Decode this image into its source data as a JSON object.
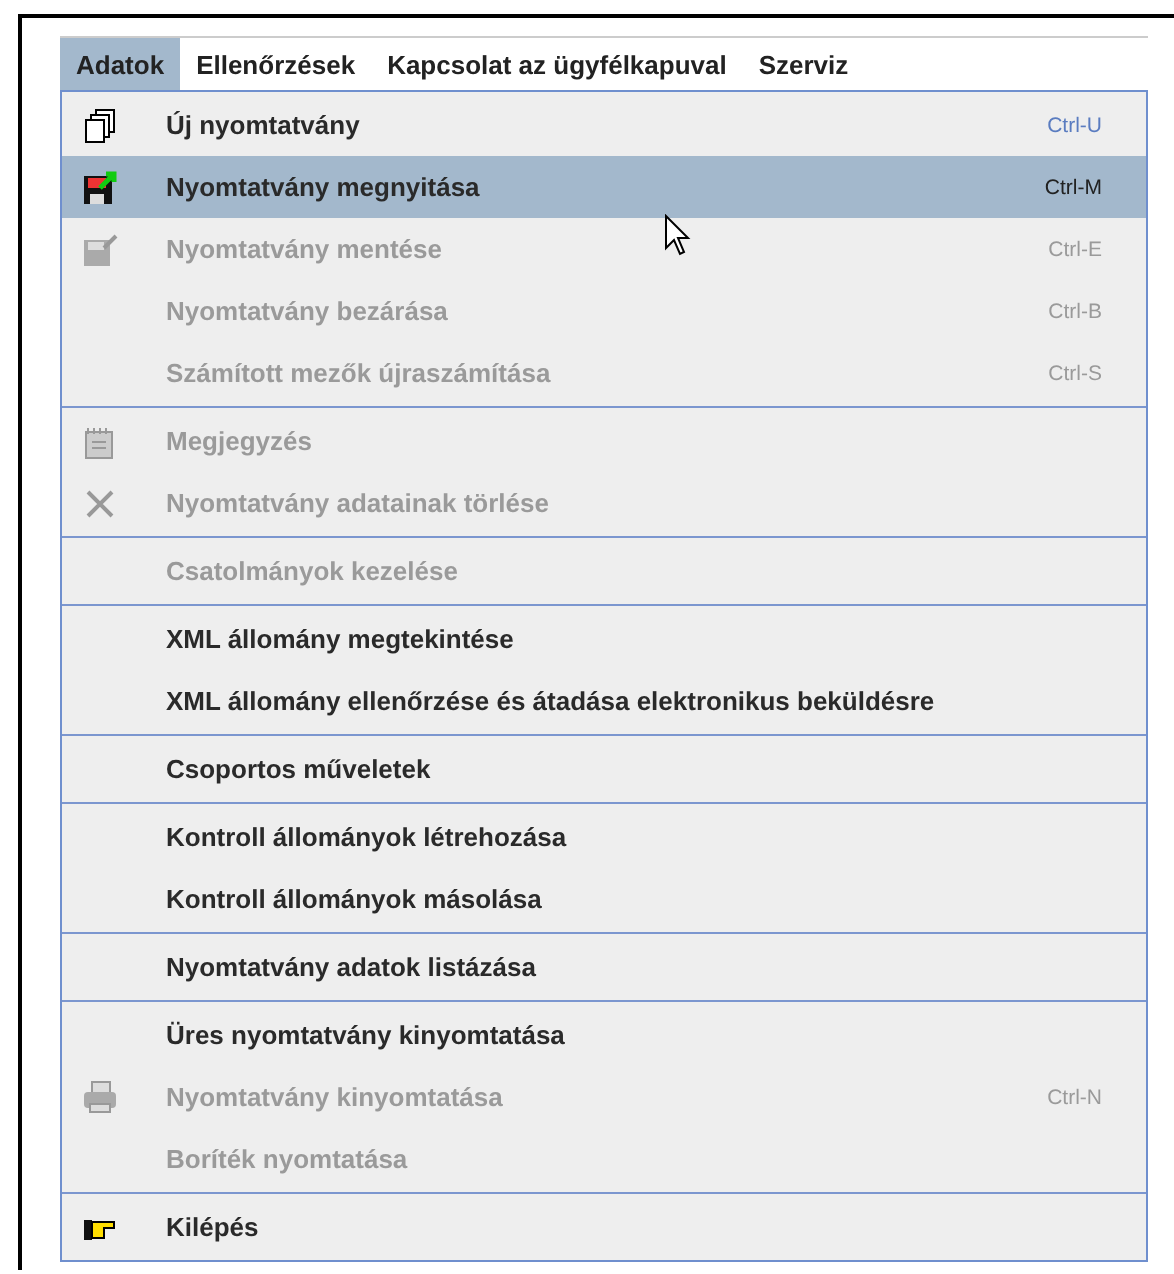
{
  "menubar": {
    "menus": [
      {
        "label": "Adatok",
        "selected": true
      },
      {
        "label": "Ellenőrzések",
        "selected": false
      },
      {
        "label": "Kapcsolat az ügyfélkapuval",
        "selected": false
      },
      {
        "label": "Szerviz",
        "selected": false
      }
    ]
  },
  "menu": {
    "groups": [
      {
        "items": [
          {
            "label": "Új nyomtatvány",
            "shortcut": "Ctrl-U",
            "kind": "pages",
            "disabled": false,
            "selected": false
          },
          {
            "label": "Nyomtatvány megnyitása",
            "shortcut": "Ctrl-M",
            "kind": "open",
            "disabled": false,
            "selected": true
          },
          {
            "label": "Nyomtatvány mentése",
            "shortcut": "Ctrl-E",
            "kind": "save",
            "disabled": true,
            "selected": false
          },
          {
            "label": "Nyomtatvány bezárása",
            "shortcut": "Ctrl-B",
            "kind": "plain",
            "disabled": true,
            "selected": false
          },
          {
            "label": "Számított mezők újraszámítása",
            "shortcut": "Ctrl-S",
            "kind": "plain",
            "disabled": true,
            "selected": false
          }
        ]
      },
      {
        "items": [
          {
            "label": "Megjegyzés",
            "kind": "note",
            "disabled": true,
            "selected": false
          },
          {
            "label": "Nyomtatvány adatainak törlése",
            "kind": "delete",
            "disabled": true,
            "selected": false
          }
        ]
      },
      {
        "items": [
          {
            "label": "Csatolmányok kezelése",
            "kind": "plain",
            "disabled": true,
            "selected": false
          }
        ]
      },
      {
        "items": [
          {
            "label": "XML állomány megtekintése",
            "kind": "plain",
            "disabled": false,
            "selected": false
          },
          {
            "label": "XML állomány ellenőrzése és átadása elektronikus beküldésre",
            "kind": "plain",
            "disabled": false,
            "selected": false
          }
        ]
      },
      {
        "items": [
          {
            "label": "Csoportos műveletek",
            "kind": "plain",
            "disabled": false,
            "selected": false
          }
        ]
      },
      {
        "items": [
          {
            "label": "Kontroll állományok létrehozása",
            "kind": "plain",
            "disabled": false,
            "selected": false
          },
          {
            "label": "Kontroll állományok másolása",
            "kind": "plain",
            "disabled": false,
            "selected": false
          }
        ]
      },
      {
        "items": [
          {
            "label": "Nyomtatvány adatok listázása",
            "kind": "plain",
            "disabled": false,
            "selected": false
          }
        ]
      },
      {
        "items": [
          {
            "label": "Üres nyomtatvány kinyomtatása",
            "kind": "plain",
            "disabled": false,
            "selected": false
          },
          {
            "label": "Nyomtatvány kinyomtatása",
            "shortcut": "Ctrl-N",
            "kind": "print",
            "disabled": true,
            "selected": false
          },
          {
            "label": "Boríték nyomtatása",
            "kind": "plain",
            "disabled": true,
            "selected": false
          }
        ]
      },
      {
        "items": [
          {
            "label": "Kilépés",
            "kind": "exit",
            "disabled": false,
            "selected": false
          }
        ]
      }
    ]
  }
}
